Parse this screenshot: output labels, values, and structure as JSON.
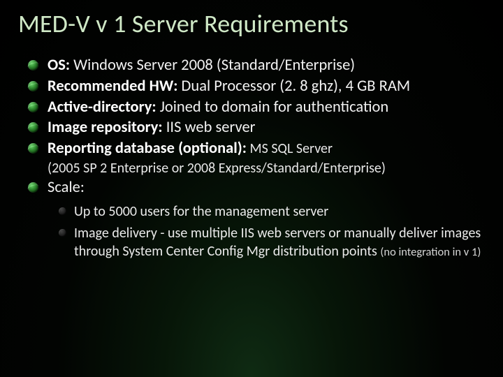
{
  "title": "MED-V v 1 Server Requirements",
  "items": [
    {
      "label": "OS:",
      "text": " Windows Server 2008 (Standard/Enterprise)"
    },
    {
      "label": "Recommended HW:",
      "text": " Dual Processor (2. 8 ghz), 4 GB RAM"
    },
    {
      "label": "Active-directory:",
      "text": " Joined to domain for authentication"
    },
    {
      "label": "Image repository:",
      "text": " IIS web server"
    },
    {
      "label": "Reporting database (optional):",
      "text": " MS SQL Server",
      "aside": "(2005 SP 2 Enterprise or 2008 Express/Standard/Enterprise)"
    },
    {
      "label": "Scale",
      "text": ":"
    }
  ],
  "sub": [
    {
      "text": "Up to 5000 users for the management server"
    },
    {
      "text": "Image delivery - use multiple IIS web servers or manually deliver images through System Center Config Mgr distribution points ",
      "small": "(no integration in v 1)"
    }
  ]
}
